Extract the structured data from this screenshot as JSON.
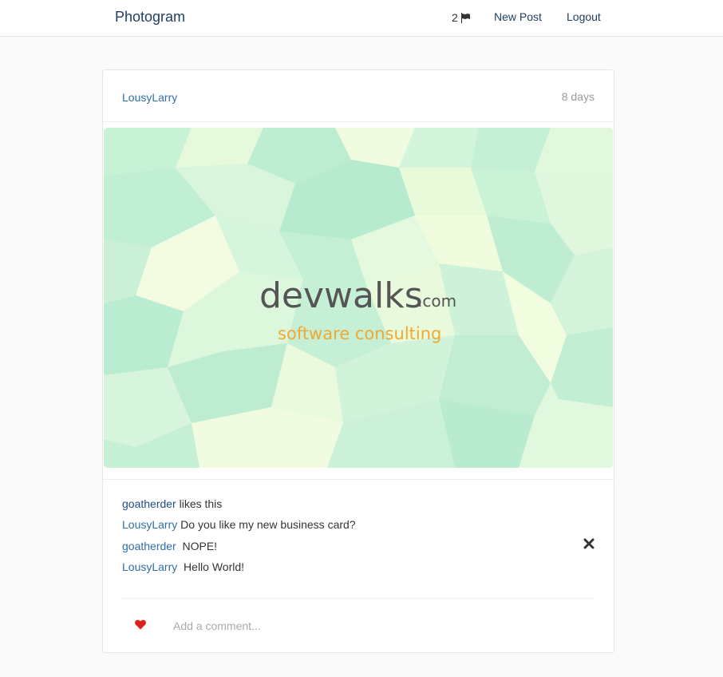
{
  "navbar": {
    "brand": "Photogram",
    "notification_count": "2",
    "new_post_label": "New Post",
    "logout_label": "Logout"
  },
  "post": {
    "author": "LousyLarry",
    "age": "8 days",
    "image": {
      "logo_word": "devwalks",
      "logo_domain": ".com",
      "tagline": "software consulting"
    },
    "likes": {
      "user": "goatherder",
      "text": "likes this"
    },
    "caption": {
      "user": "LousyLarry",
      "text": "Do you like my new business card?"
    },
    "comments": [
      {
        "user": "goatherder",
        "text": "NOPE!"
      },
      {
        "user": "LousyLarry",
        "text": "Hello World!"
      }
    ],
    "comment_placeholder": "Add a comment..."
  },
  "colors": {
    "brand": "#1f3f63",
    "link": "#2f6ea6",
    "heart": "#e0201c",
    "tagline": "#f0a833"
  }
}
